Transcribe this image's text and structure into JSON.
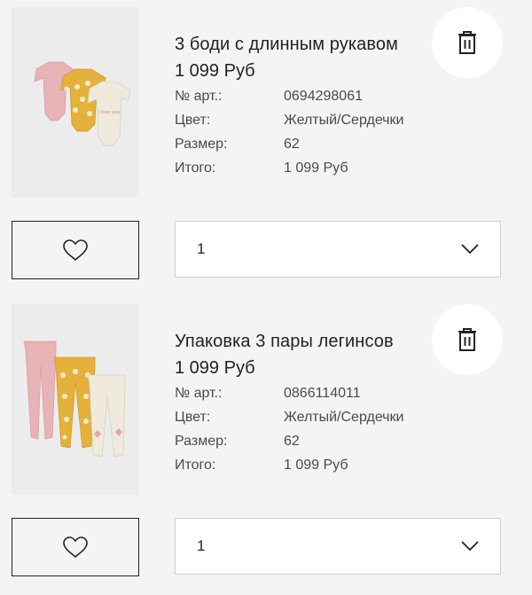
{
  "labels": {
    "article": "№ арт.:",
    "color": "Цвет:",
    "size": "Размер:",
    "total": "Итого:"
  },
  "items": [
    {
      "title": "3 боди с длинным рукавом",
      "price": "1 099 Руб",
      "article": "0694298061",
      "color": "Желтый/Сердечки",
      "size": "62",
      "total": "1 099 Руб",
      "quantity": "1",
      "print_text": "I love you"
    },
    {
      "title": "Упаковка 3 пары легинсов",
      "price": "1 099 Руб",
      "article": "0866114011",
      "color": "Желтый/Сердечки",
      "size": "62",
      "total": "1 099 Руб",
      "quantity": "1"
    }
  ],
  "icons": {
    "delete": "trash-icon",
    "favorite": "heart-icon",
    "dropdown": "chevron-down-icon"
  },
  "colors": {
    "background": "#f4f4f4",
    "image_background": "#ececec",
    "pink": "#e7b3b6",
    "mustard": "#e4b13a",
    "cream": "#efeadb"
  }
}
